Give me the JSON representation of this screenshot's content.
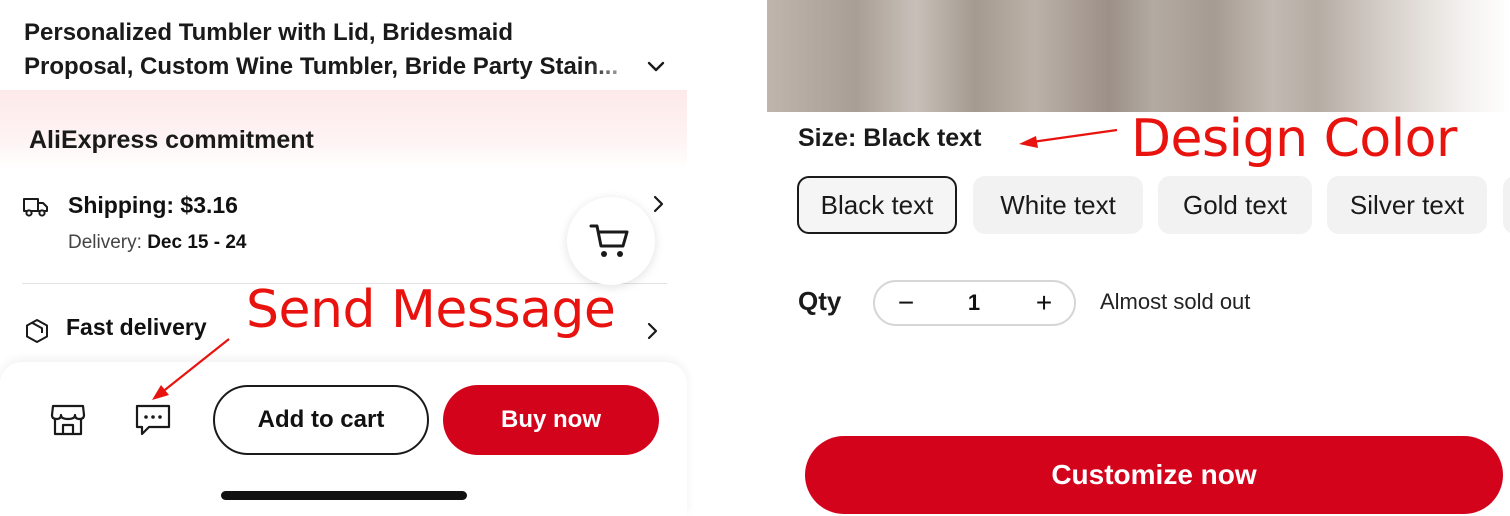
{
  "product": {
    "title_line1": "Personalized Tumbler with Lid, Bridesmaid",
    "title_line2": "Proposal, Custom Wine Tumbler, Bride Party Stain..."
  },
  "commitment": {
    "title": "AliExpress commitment",
    "shipping": "Shipping: $3.16",
    "delivery_label": "Delivery: ",
    "delivery_dates": "Dec 15 - 24",
    "fast_delivery": "Fast delivery"
  },
  "bottom_bar": {
    "add_to_cart": "Add to cart",
    "buy_now": "Buy now"
  },
  "annotations": {
    "send_message": "Send Message",
    "design_color": "Design Color"
  },
  "options": {
    "size_label": "Size: Black text",
    "chips": [
      "Black text",
      "White text",
      "Gold text",
      "Silver text"
    ],
    "selected": "Black text"
  },
  "quantity": {
    "label": "Qty",
    "minus": "−",
    "value": "1",
    "plus": "+",
    "stock_status": "Almost sold out"
  },
  "actions": {
    "customize": "Customize now"
  },
  "colors": {
    "brand_red": "#d3031c",
    "annotation_red": "#e8130f"
  },
  "icons": [
    "chevron-down-icon",
    "truck-icon",
    "chevron-right-icon",
    "cart-icon",
    "box-icon",
    "store-icon",
    "message-icon"
  ]
}
